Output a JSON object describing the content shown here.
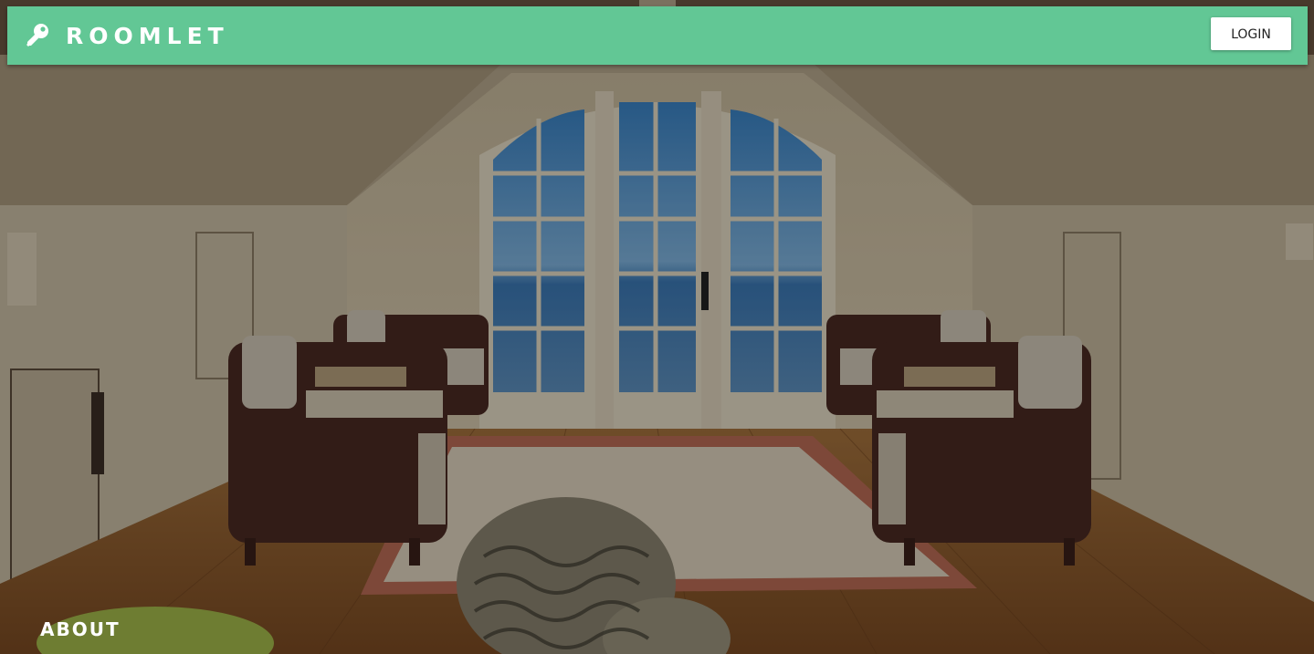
{
  "navbar": {
    "brand_icon": "key-icon",
    "brand_name": "ROOMLET",
    "login_label": "LOGIN",
    "accent_color": "#62c795"
  },
  "hero": {
    "image": "attic-room-photo",
    "section_link_label": "ABOUT"
  }
}
